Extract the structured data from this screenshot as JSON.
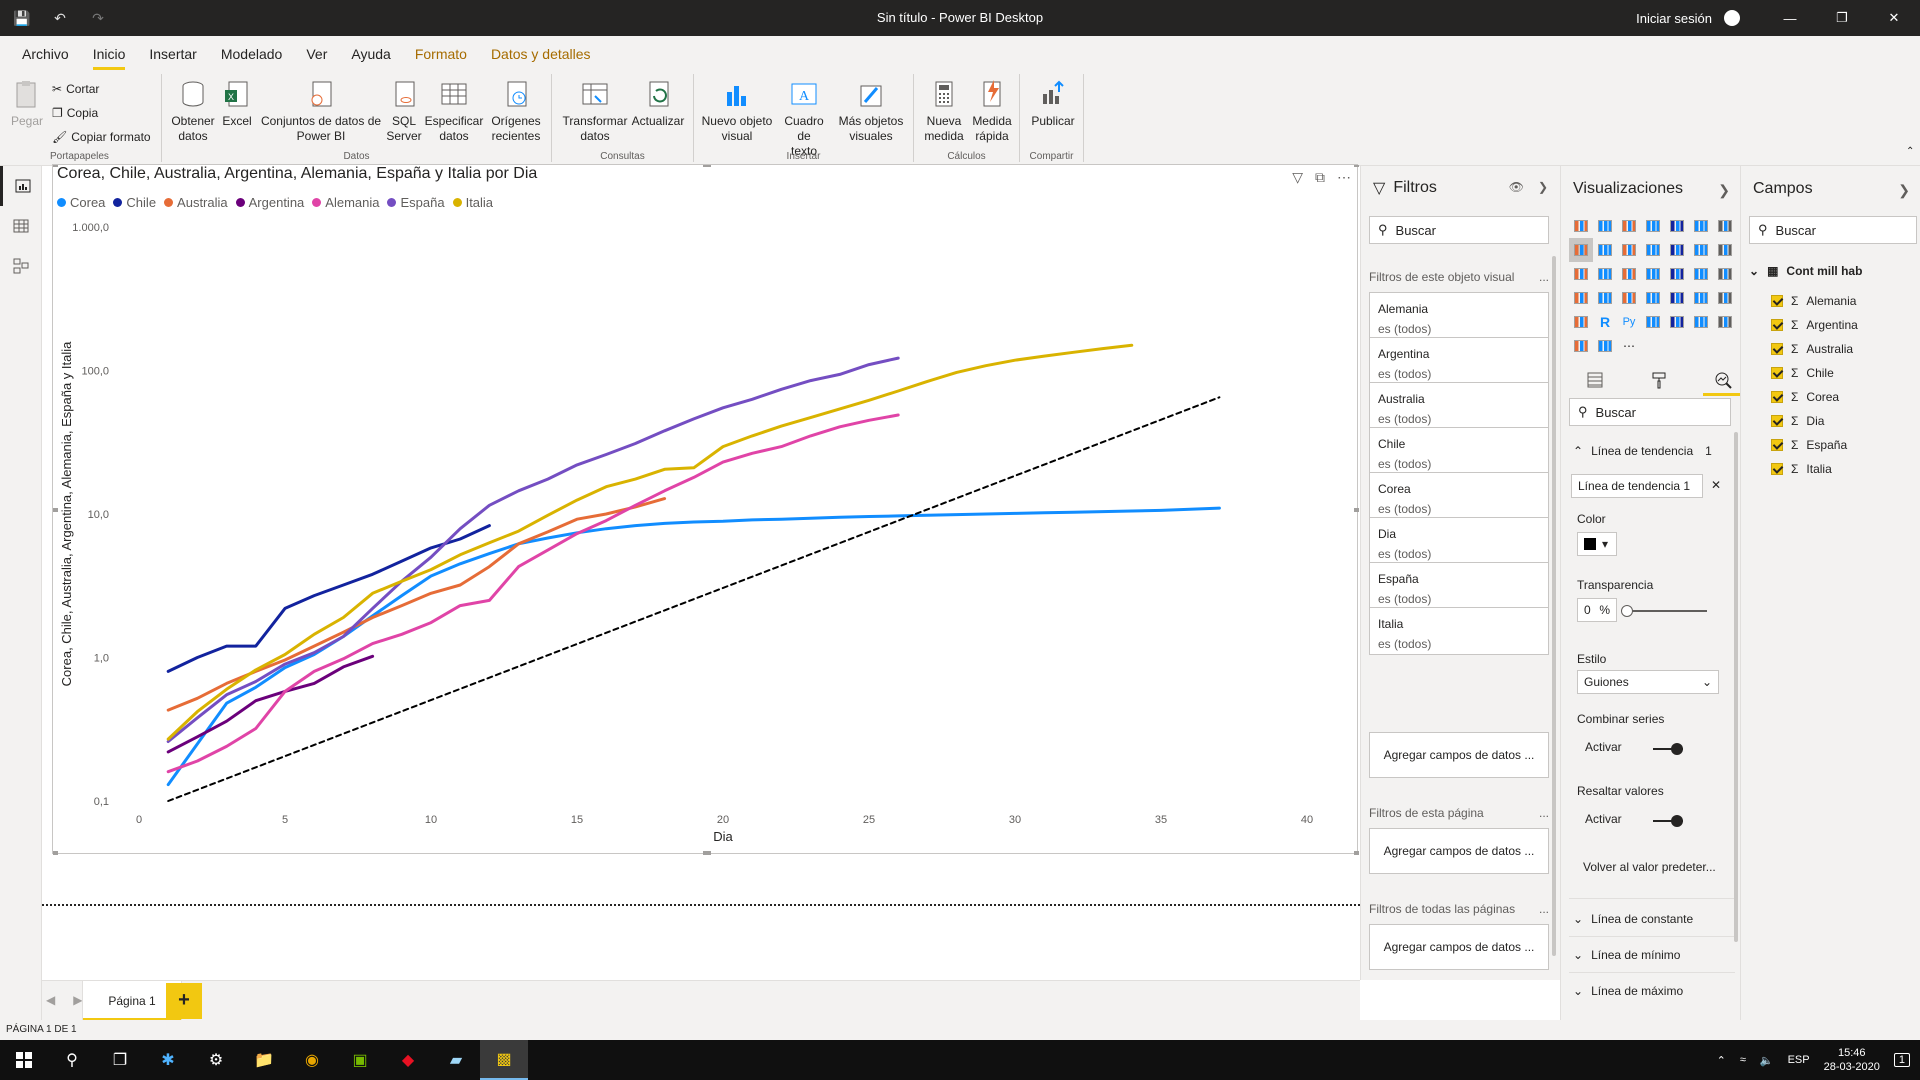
{
  "window": {
    "title": "Sin título - Power BI Desktop",
    "signin": "Iniciar sesión"
  },
  "ribbon": {
    "tabs": [
      "Archivo",
      "Inicio",
      "Insertar",
      "Modelado",
      "Ver",
      "Ayuda",
      "Formato",
      "Datos y detalles"
    ],
    "active_tab": "Inicio",
    "clipboard": {
      "paste": "Pegar",
      "cut": "Cortar",
      "copy": "Copia",
      "format_painter": "Copiar formato",
      "group": "Portapapeles"
    },
    "data": {
      "get_data_1": "Obtener",
      "get_data_2": "datos",
      "excel": "Excel",
      "datasets_1": "Conjuntos de datos de",
      "datasets_2": "Power BI",
      "sql_1": "SQL",
      "sql_2": "Server",
      "enter_1": "Especificar",
      "enter_2": "datos",
      "recent_1": "Orígenes",
      "recent_2": "recientes",
      "group": "Datos"
    },
    "queries": {
      "transform_1": "Transformar",
      "transform_2": "datos",
      "refresh": "Actualizar",
      "group": "Consultas"
    },
    "insert": {
      "new_visual_1": "Nuevo objeto",
      "new_visual_2": "visual",
      "textbox_1": "Cuadro de",
      "textbox_2": "texto",
      "more_visuals_1": "Más objetos",
      "more_visuals_2": "visuales",
      "group": "Insertar"
    },
    "calc": {
      "new_measure_1": "Nueva",
      "new_measure_2": "medida",
      "quick_measure_1": "Medida",
      "quick_measure_2": "rápida",
      "group": "Cálculos"
    },
    "share": {
      "publish": "Publicar",
      "group": "Compartir"
    }
  },
  "visual": {
    "title": "Corea, Chile, Australia, Argentina, Alemania, España y Italia por Dia"
  },
  "chart_data": {
    "type": "line",
    "title": "Corea, Chile, Australia, Argentina, Alemania, España y Italia por Dia",
    "xlabel": "Dia",
    "ylabel": "Corea, Chile, Australia, Argentina, Alemania, España y Italia",
    "xlim": [
      0,
      40
    ],
    "ylim": [
      0.1,
      1000
    ],
    "yscale": "log",
    "xticks": [
      "0",
      "5",
      "10",
      "15",
      "20",
      "25",
      "30",
      "35",
      "40"
    ],
    "yticks": [
      "0,1",
      "1,0",
      "10,0",
      "100,0",
      "1.000,0"
    ],
    "ytick_values": [
      0.1,
      1,
      10,
      100,
      1000
    ],
    "xtick_values": [
      0,
      5,
      10,
      15,
      20,
      25,
      30,
      35,
      40
    ],
    "legend_position": "top-left",
    "series": [
      {
        "name": "Corea",
        "color": "#118DFF",
        "x": [
          1,
          2,
          3,
          4,
          5,
          6,
          7,
          8,
          9,
          10,
          11,
          12,
          13,
          14,
          15,
          16,
          17,
          18,
          19,
          20,
          21,
          22,
          23,
          24,
          25,
          26,
          27,
          28,
          29,
          30,
          31,
          32,
          33,
          34,
          35,
          36,
          37
        ],
        "y": [
          0.13,
          0.25,
          0.48,
          0.62,
          0.85,
          1.05,
          1.4,
          1.95,
          2.7,
          3.7,
          4.5,
          5.3,
          6.2,
          6.8,
          7.4,
          7.9,
          8.3,
          8.6,
          8.8,
          8.9,
          9.1,
          9.2,
          9.35,
          9.5,
          9.6,
          9.7,
          9.8,
          9.9,
          10.0,
          10.1,
          10.2,
          10.3,
          10.4,
          10.5,
          10.6,
          10.8,
          11.0
        ]
      },
      {
        "name": "Chile",
        "color": "#12239E",
        "x": [
          1,
          2,
          3,
          4,
          5,
          6,
          7,
          8,
          9,
          10,
          11,
          12
        ],
        "y": [
          0.8,
          1.0,
          1.2,
          1.2,
          2.2,
          2.7,
          3.2,
          3.8,
          4.7,
          5.8,
          6.7,
          8.3
        ]
      },
      {
        "name": "Australia",
        "color": "#E66C37",
        "x": [
          1,
          2,
          3,
          4,
          5,
          6,
          7,
          8,
          9,
          10,
          11,
          12,
          13,
          14,
          15,
          16,
          17,
          18
        ],
        "y": [
          0.43,
          0.52,
          0.66,
          0.8,
          0.96,
          1.2,
          1.5,
          1.9,
          2.3,
          2.8,
          3.2,
          4.3,
          6.2,
          7.5,
          9.2,
          10.0,
          11.2,
          12.8
        ]
      },
      {
        "name": "Argentina",
        "color": "#6B007B",
        "x": [
          1,
          2,
          3,
          4,
          5,
          6,
          7,
          8
        ],
        "y": [
          0.22,
          0.28,
          0.36,
          0.5,
          0.58,
          0.66,
          0.86,
          1.02
        ]
      },
      {
        "name": "Alemania",
        "color": "#E044A7",
        "x": [
          1,
          2,
          3,
          4,
          5,
          6,
          7,
          8,
          9,
          10,
          11,
          12,
          13,
          14,
          15,
          16,
          17,
          18,
          19,
          20,
          21,
          22,
          23,
          24,
          25,
          26
        ],
        "y": [
          0.16,
          0.19,
          0.24,
          0.32,
          0.58,
          0.8,
          0.98,
          1.25,
          1.45,
          1.75,
          2.3,
          2.5,
          4.3,
          5.6,
          7.3,
          9.0,
          11.5,
          14.5,
          18.0,
          23.0,
          26.5,
          29.5,
          35.0,
          40.5,
          45.0,
          49.0
        ]
      },
      {
        "name": "España",
        "color": "#744EC2",
        "x": [
          1,
          2,
          3,
          4,
          5,
          6,
          7,
          8,
          9,
          10,
          11,
          12,
          13,
          14,
          15,
          16,
          17,
          18,
          19,
          20,
          21,
          22,
          23,
          24,
          25,
          26
        ],
        "y": [
          0.26,
          0.38,
          0.55,
          0.68,
          0.9,
          1.08,
          1.4,
          2.2,
          3.4,
          5.0,
          7.9,
          11.5,
          14.5,
          17.5,
          22.0,
          26.0,
          31.0,
          38.0,
          46.0,
          55.0,
          63.0,
          74.0,
          85.0,
          94.0,
          110.0,
          122.0
        ]
      },
      {
        "name": "Italia",
        "color": "#D9B300",
        "x": [
          1,
          2,
          3,
          4,
          5,
          6,
          7,
          8,
          9,
          10,
          11,
          12,
          13,
          14,
          15,
          16,
          17,
          18,
          19,
          20,
          21,
          22,
          23,
          24,
          25,
          26,
          27,
          28,
          29,
          30,
          31,
          32,
          33,
          34
        ],
        "y": [
          0.27,
          0.42,
          0.6,
          0.82,
          1.05,
          1.45,
          1.9,
          2.8,
          3.4,
          4.1,
          5.2,
          6.3,
          7.6,
          9.8,
          12.5,
          15.5,
          17.5,
          20.5,
          21.0,
          29.5,
          35.0,
          41.0,
          47.0,
          54.0,
          62.0,
          72.0,
          84.0,
          97.0,
          108.0,
          118.0,
          126.0,
          134.0,
          142.0,
          150.0
        ]
      },
      {
        "name": "Línea de tendencia 1",
        "color": "#000000",
        "dashed": true,
        "x": [
          1,
          37
        ],
        "y": [
          0.1,
          65.0
        ]
      }
    ]
  },
  "filters": {
    "title": "Filtros",
    "search": "Buscar",
    "section_visual": "Filtros de este objeto visual",
    "cards": [
      {
        "name": "Alemania",
        "value": "es (todos)"
      },
      {
        "name": "Argentina",
        "value": "es (todos)"
      },
      {
        "name": "Australia",
        "value": "es (todos)"
      },
      {
        "name": "Chile",
        "value": "es (todos)"
      },
      {
        "name": "Corea",
        "value": "es (todos)"
      },
      {
        "name": "Dia",
        "value": "es (todos)"
      },
      {
        "name": "España",
        "value": "es (todos)"
      },
      {
        "name": "Italia",
        "value": "es (todos)"
      }
    ],
    "add_fields": "Agregar campos de datos ...",
    "section_page": "Filtros de esta página",
    "section_all": "Filtros de todas las páginas",
    "more": "..."
  },
  "viz": {
    "title": "Visualizaciones",
    "search": "Buscar",
    "trend_header": "Línea de tendencia",
    "trend_count": "1",
    "trend_item": "Línea de tendencia 1",
    "color_label": "Color",
    "transparency_label": "Transparencia",
    "transparency_value": "0",
    "transparency_unit": "%",
    "style_label": "Estilo",
    "style_value": "Guiones",
    "combine_label": "Combinar series",
    "combine_value": "Activar",
    "highlight_label": "Resaltar valores",
    "highlight_value": "Activar",
    "reset": "Volver al valor predeter...",
    "constant_line": "Línea de constante",
    "min_line": "Línea de mínimo",
    "max_line": "Línea de máximo",
    "more_dots": "..."
  },
  "fields": {
    "title": "Campos",
    "search": "Buscar",
    "table": "Cont mill hab",
    "items": [
      "Alemania",
      "Argentina",
      "Australia",
      "Chile",
      "Corea",
      "Dia",
      "España",
      "Italia"
    ]
  },
  "pages": {
    "tab": "Página 1",
    "add": "+"
  },
  "status": {
    "text": "PÁGINA 1 DE 1"
  },
  "taskbar": {
    "lang": "ESP",
    "time": "15:46",
    "date": "28-03-2020",
    "notif": "1"
  }
}
